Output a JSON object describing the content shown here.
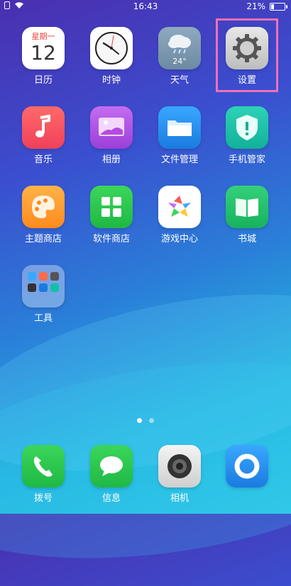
{
  "status_bar": {
    "time": "16:43",
    "battery_text": "21%",
    "battery_level": 0.21
  },
  "calendar": {
    "weekday": "星期一",
    "day": "12"
  },
  "weather": {
    "temp": "24°"
  },
  "apps": {
    "calendar": "日历",
    "clock": "时钟",
    "weather": "天气",
    "settings": "设置",
    "music": "音乐",
    "album": "相册",
    "files": "文件管理",
    "phone_manager": "手机管家",
    "theme_store": "主题商店",
    "software_store": "软件商店",
    "game_center": "游戏中心",
    "bookstore": "书城",
    "tools": "工具"
  },
  "dock": {
    "phone": "拨号",
    "messages": "信息",
    "camera": "相机",
    "browser": ""
  },
  "page_indicator": {
    "current": 1,
    "total": 2
  },
  "colors": {
    "highlight": "#f26fb8"
  }
}
